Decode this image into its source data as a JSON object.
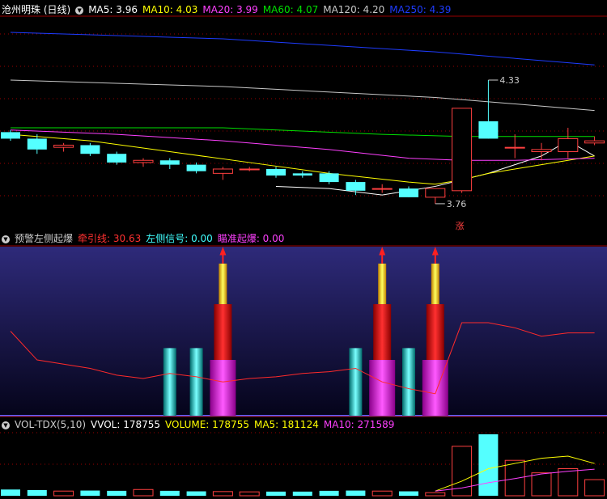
{
  "colors": {
    "up": "#ff4040",
    "down": "#54ffff",
    "white": "#ffffff",
    "yellow": "#ffff00",
    "magenta": "#ff40ff",
    "green": "#00e000",
    "ma120": "#c8c8c8",
    "blue": "#1e3cff",
    "grid": "#9a0000",
    "panel_line": "#ff2a2a"
  },
  "icons": {
    "collapse": "chevron-down-icon"
  },
  "main": {
    "title": "沧州明珠 (日线)",
    "ma_labels": [
      {
        "text": "MA5: 3.96",
        "color": "#ffffff"
      },
      {
        "text": "MA10: 4.03",
        "color": "#ffff00"
      },
      {
        "text": "MA20: 3.99",
        "color": "#ff40ff"
      },
      {
        "text": "MA60: 4.07",
        "color": "#00e000"
      },
      {
        "text": "MA120: 4.20",
        "color": "#c8c8c8"
      },
      {
        "text": "MA250: 4.39",
        "color": "#1e3cff"
      }
    ],
    "high_label": "4.33",
    "low_label": "3.76",
    "mark_label": "涨"
  },
  "ind": {
    "title": "预警左侧起爆",
    "labels": [
      {
        "text": "牵引线: 30.63",
        "color": "#ff3030"
      },
      {
        "text": "左侧信号: 0.00",
        "color": "#40ffff"
      },
      {
        "text": "瞄准起爆: 0.00",
        "color": "#ff40ff"
      }
    ]
  },
  "vol": {
    "title": "VOL-TDX(5,10)",
    "labels": [
      {
        "text": "VVOL: 178755",
        "color": "#ffffff"
      },
      {
        "text": "VOLUME: 178755",
        "color": "#ffff00"
      },
      {
        "text": "MA5: 181124",
        "color": "#ffff00"
      },
      {
        "text": "MA10: 271589",
        "color": "#ff40ff"
      }
    ]
  },
  "chart_data": [
    {
      "type": "candlestick",
      "panel": "price",
      "price_range": [
        3.7,
        4.55
      ],
      "candles": [
        {
          "o": 4.09,
          "c": 4.06,
          "h": 4.1,
          "l": 4.05
        },
        {
          "o": 4.06,
          "c": 4.01,
          "h": 4.08,
          "l": 3.99
        },
        {
          "o": 4.02,
          "c": 4.03,
          "h": 4.04,
          "l": 4.0
        },
        {
          "o": 4.03,
          "c": 3.99,
          "h": 4.04,
          "l": 3.98
        },
        {
          "o": 3.99,
          "c": 3.95,
          "h": 4.0,
          "l": 3.94
        },
        {
          "o": 3.95,
          "c": 3.96,
          "h": 3.97,
          "l": 3.93
        },
        {
          "o": 3.96,
          "c": 3.94,
          "h": 3.97,
          "l": 3.92
        },
        {
          "o": 3.94,
          "c": 3.91,
          "h": 3.95,
          "l": 3.9
        },
        {
          "o": 3.9,
          "c": 3.92,
          "h": 3.93,
          "l": 3.87
        },
        {
          "o": 3.92,
          "c": 3.92,
          "h": 3.93,
          "l": 3.91
        },
        {
          "o": 3.92,
          "c": 3.89,
          "h": 3.93,
          "l": 3.88
        },
        {
          "o": 3.9,
          "c": 3.89,
          "h": 3.91,
          "l": 3.88
        },
        {
          "o": 3.9,
          "c": 3.86,
          "h": 3.91,
          "l": 3.85
        },
        {
          "o": 3.86,
          "c": 3.82,
          "h": 3.87,
          "l": 3.8
        },
        {
          "o": 3.83,
          "c": 3.83,
          "h": 3.85,
          "l": 3.81
        },
        {
          "o": 3.83,
          "c": 3.79,
          "h": 3.84,
          "l": 3.79
        },
        {
          "o": 3.79,
          "c": 3.83,
          "h": 3.83,
          "l": 3.76
        },
        {
          "o": 3.82,
          "c": 4.2,
          "h": 4.2,
          "l": 3.81
        },
        {
          "o": 4.14,
          "c": 4.06,
          "h": 4.33,
          "l": 4.06
        },
        {
          "o": 4.02,
          "c": 4.02,
          "h": 4.08,
          "l": 3.97
        },
        {
          "o": 4.0,
          "c": 4.01,
          "h": 4.04,
          "l": 3.96
        },
        {
          "o": 4.0,
          "c": 4.06,
          "h": 4.11,
          "l": 3.97
        },
        {
          "o": 4.04,
          "c": 4.05,
          "h": 4.07,
          "l": 4.03
        }
      ],
      "ma_lines": [
        {
          "name": "MA5",
          "color": "#ffffff",
          "x": [
            10,
            12,
            14,
            16,
            18,
            19,
            20,
            21,
            22
          ],
          "y": [
            3.84,
            3.83,
            3.8,
            3.84,
            3.9,
            3.94,
            3.98,
            4.05,
            3.98
          ]
        },
        {
          "name": "MA10",
          "color": "#ffff00",
          "x": [
            0,
            3,
            6,
            9,
            12,
            15,
            16,
            17,
            18,
            19,
            20,
            21,
            22
          ],
          "y": [
            4.08,
            4.05,
            4.0,
            3.95,
            3.9,
            3.86,
            3.85,
            3.87,
            3.9,
            3.92,
            3.94,
            3.96,
            3.98
          ]
        },
        {
          "name": "MA20",
          "color": "#ff40ff",
          "x": [
            0,
            4,
            8,
            12,
            15,
            17,
            19,
            22
          ],
          "y": [
            4.1,
            4.08,
            4.05,
            4.01,
            3.97,
            3.96,
            3.96,
            3.97
          ]
        },
        {
          "name": "MA60",
          "color": "#00e000",
          "x": [
            0,
            8,
            14,
            17,
            22
          ],
          "y": [
            4.11,
            4.11,
            4.08,
            4.07,
            4.07
          ]
        },
        {
          "name": "MA120",
          "color": "#c8c8c8",
          "x": [
            0,
            8,
            16,
            22
          ],
          "y": [
            4.33,
            4.3,
            4.25,
            4.19
          ]
        },
        {
          "name": "MA250",
          "color": "#1e3cff",
          "x": [
            0,
            8,
            16,
            22
          ],
          "y": [
            4.55,
            4.52,
            4.46,
            4.4
          ]
        }
      ]
    },
    {
      "type": "bar",
      "panel": "indicator",
      "range": [
        0,
        100
      ],
      "traction_line": {
        "x": [
          0,
          1,
          3,
          4,
          5,
          6,
          7,
          8,
          9,
          10,
          11,
          12,
          13,
          14,
          15,
          16,
          17,
          18,
          19,
          20,
          21,
          22
        ],
        "y": [
          50,
          33,
          28,
          24,
          22,
          25,
          23,
          20,
          22,
          23,
          25,
          26,
          28,
          20,
          16,
          13,
          55,
          55,
          52,
          47,
          49,
          49
        ]
      },
      "left_signal_bars": [
        6,
        7,
        13,
        15
      ],
      "ignite_bars": [
        8,
        14,
        16
      ]
    },
    {
      "type": "bar",
      "panel": "volume",
      "volumes": [
        120,
        110,
        90,
        100,
        95,
        120,
        95,
        85,
        80,
        75,
        80,
        80,
        95,
        100,
        90,
        85,
        60,
        950,
        1180,
        680,
        440,
        520,
        310
      ],
      "ma5": {
        "x": [
          16,
          17,
          18,
          19,
          20,
          21,
          22
        ],
        "y": [
          90,
          280,
          520,
          620,
          720,
          760,
          620
        ]
      },
      "ma10": {
        "x": [
          16,
          17,
          18,
          19,
          20,
          21,
          22
        ],
        "y": [
          90,
          150,
          250,
          330,
          420,
          470,
          510
        ]
      }
    }
  ]
}
